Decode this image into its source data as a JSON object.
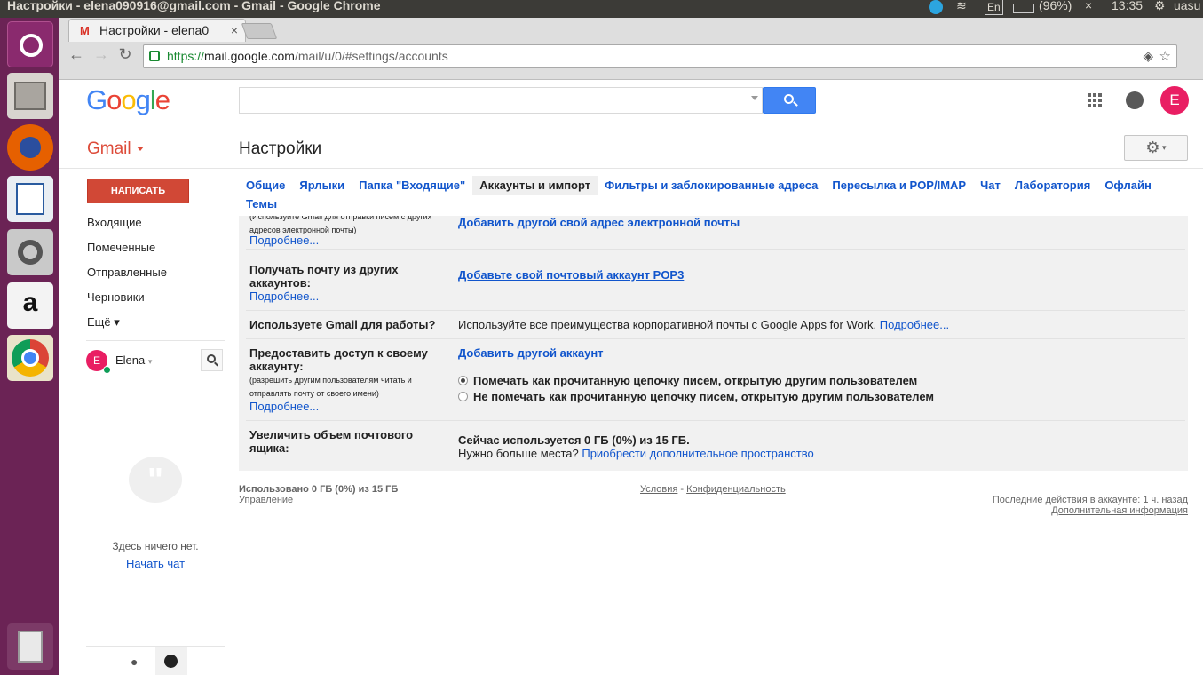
{
  "os": {
    "window_title": "Настройки - elena090916@gmail.com - Gmail - Google Chrome",
    "lang": "En",
    "battery": "(96%)",
    "time": "13:35",
    "user": "uasu",
    "launcher_icons": [
      "ubuntu-dash-icon",
      "files-icon",
      "firefox-icon",
      "writer-icon",
      "settings-icon",
      "amazon-icon",
      "chrome-icon",
      "trash-icon"
    ]
  },
  "browser": {
    "tab_title": "Настройки - elena0",
    "tab_close": "×",
    "url_scheme": "https://",
    "url_host": "mail.google.com",
    "url_path": "/mail/u/0/#settings/accounts"
  },
  "header": {
    "logo": "Google",
    "search_placeholder": "",
    "avatar_letter": "E"
  },
  "gmail": {
    "label": "Gmail",
    "page_title": "Настройки",
    "compose": "НАПИСАТЬ",
    "folders": [
      "Входящие",
      "Помеченные",
      "Отправленные",
      "Черновики",
      "Ещё ▾"
    ],
    "chat_user": "Elena",
    "chat_user_letter": "E",
    "chat_empty": "Здесь ничего нет.",
    "chat_start": "Начать чат"
  },
  "tabs": [
    "Общие",
    "Ярлыки",
    "Папка \"Входящие\"",
    "Аккаунты и импорт",
    "Фильтры и заблокированные адреса",
    "Пересылка и POP/IMAP",
    "Чат",
    "Лаборатория",
    "Офлайн",
    "Темы"
  ],
  "settings": {
    "row1_note": "(Используйте Gmail для отправки писем с других адресов электронной почты)",
    "row1_more": "Подробнее...",
    "row1_action": "Добавить другой свой адрес электронной почты",
    "row2_label": "Получать почту из других аккаунтов:",
    "row2_more": "Подробнее...",
    "row2_action": "Добавьте свой почтовый аккаунт POP3",
    "row3_label": "Используете Gmail для работы?",
    "row3_text": "Используйте все преимущества корпоративной почты с Google Apps for Work.",
    "row3_link": "Подробнее...",
    "row4_label": "Предоставить доступ к своему аккаунту:",
    "row4_note": "(разрешить другим пользователям читать и отправлять почту от своего имени)",
    "row4_more": "Подробнее...",
    "row4_action": "Добавить другой аккаунт",
    "row4_opt1": "Помечать как прочитанную цепочку писем, открытую другим пользователем",
    "row4_opt2": "Не помечать как прочитанную цепочку писем, открытую другим пользователем",
    "row5_label": "Увеличить объем почтового ящика:",
    "row5_used": "Сейчас используется 0 ГБ (0%) из 15 ГБ.",
    "row5_more_q": "Нужно больше места?",
    "row5_link": "Приобрести дополнительное пространство"
  },
  "footer": {
    "used": "Использовано 0 ГБ (0%) из 15 ГБ",
    "manage": "Управление",
    "terms": "Условия",
    "dash": " - ",
    "privacy": "Конфиденциальность",
    "last_activity": "Последние действия в аккаунте: 1 ч. назад",
    "details": "Дополнительная информация"
  }
}
